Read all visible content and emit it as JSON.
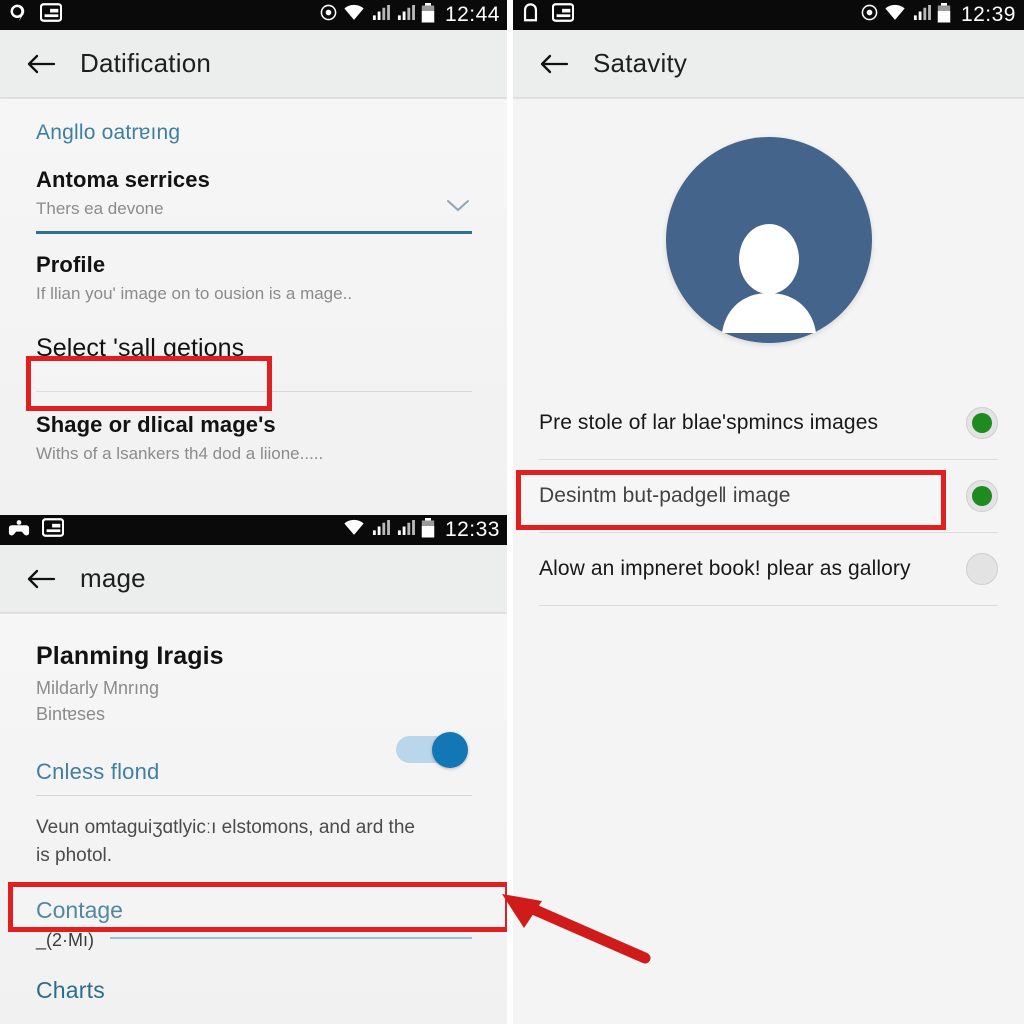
{
  "left_top_screen": {
    "status_bar": {
      "time": "12:44",
      "left_icons": [
        "search-bubble-icon",
        "inbox-icon"
      ],
      "right_icons": [
        "location-icon",
        "wifi-icon",
        "signal-icon-1",
        "signal-icon-2",
        "battery-icon"
      ]
    },
    "app_bar": {
      "back_icon": "back-arrow-icon",
      "title": "Datification"
    },
    "section_header": "Angllo oatrɐıng",
    "rows": [
      {
        "title": "Antoma serrices",
        "subtitle": "Thers ea devone",
        "trailing_icon": "chevron-down-icon"
      },
      {
        "title": "Profile",
        "subtitle": "If llian youʹ image on to ousion is a mage.."
      },
      {
        "title": "Select 'sall getions",
        "highlighted": true
      },
      {
        "title": "Shage or dlical mage's",
        "subtitle": "Withs of a lsankers th4 dod a liione....."
      }
    ]
  },
  "left_bottom_screen": {
    "status_bar": {
      "time": "12:33",
      "left_icons": [
        "game-controller-icon",
        "inbox-icon"
      ],
      "right_icons": [
        "wifi-icon",
        "signal-icon-1",
        "signal-icon-2",
        "battery-icon"
      ]
    },
    "app_bar": {
      "back_icon": "back-arrow-icon",
      "title": "mage"
    },
    "rows": [
      {
        "title": "Planming Iragis",
        "subtitle_line1": "Mildarly Mnrıng",
        "subtitle_line2": "Bintɐses",
        "toggle": "on"
      }
    ],
    "section_header": "Cnless flond",
    "body_text_line1": "Veun omtaguiʒɑtlyicːı elstomons, and ard the",
    "body_text_line2": "is photol.",
    "link_row": {
      "label": "Contage",
      "highlighted": true
    },
    "sub_value": "_(2·Μı)",
    "footer_link": "Charts"
  },
  "right_screen": {
    "status_bar": {
      "time": "12:39",
      "left_icons": [
        "bell-icon",
        "inbox-icon"
      ],
      "right_icons": [
        "location-icon",
        "wifi-icon",
        "signal-icon",
        "battery-icon"
      ]
    },
    "app_bar": {
      "back_icon": "back-arrow-icon",
      "title": "Satavity"
    },
    "avatar": {
      "icon": "person-avatar-icon",
      "color": "#45648c"
    },
    "options": [
      {
        "label": "Pre stole of lar blaeʹspmincs images",
        "selected": true,
        "highlighted": false
      },
      {
        "label": "Desintm but-padgeǁ image",
        "selected": true,
        "highlighted": true
      },
      {
        "label": "Alow an impneret book! plear as gallory",
        "selected": false,
        "highlighted": false
      }
    ]
  },
  "annotations": {
    "highlight_color": "#e02020",
    "arrow": {
      "name": "pointer-arrow",
      "color": "#d01b1b"
    }
  }
}
